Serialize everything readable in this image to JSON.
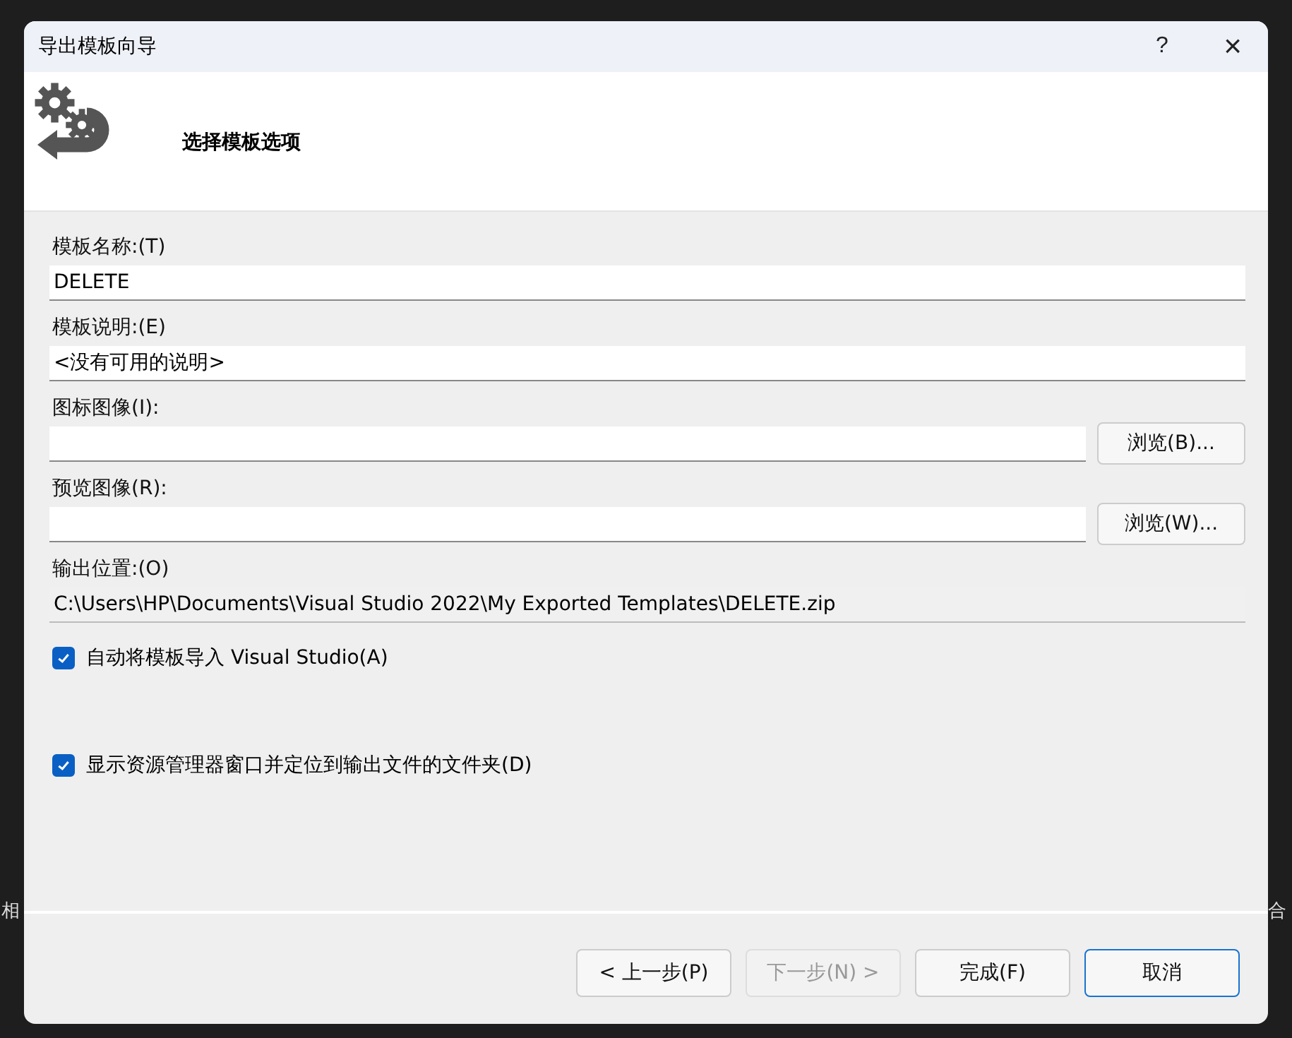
{
  "background": {
    "fragments_left": [
      "相"
    ],
    "fragments_right": [
      "合"
    ]
  },
  "window": {
    "title": "导出模板向导",
    "help": "?",
    "close": "×"
  },
  "header": {
    "title": "选择模板选项"
  },
  "fields": [
    {
      "label": "模板名称:(T)",
      "value": "DELETE",
      "kind": "text"
    },
    {
      "label": "模板说明:(E)",
      "value": "<没有可用的说明>",
      "kind": "text"
    },
    {
      "label": "图标图像(I):",
      "kind": "browse",
      "button": "浏览(B)..."
    },
    {
      "label": "预览图像(R):",
      "kind": "browse",
      "button": "浏览(W)..."
    },
    {
      "label": "输出位置:(O)",
      "value": "C:\\Users\\HP\\Documents\\Visual Studio 2022\\My Exported Templates\\DELETE.zip",
      "kind": "readonly"
    }
  ],
  "options": [
    {
      "label": "自动将模板导入 Visual Studio(A)",
      "checked": true
    },
    {
      "label": "显示资源管理器窗口并定位到输出文件的文件夹(D)",
      "checked": true
    }
  ],
  "buttons": [
    {
      "label": "< 上一步(P)",
      "disabled": false,
      "default": false
    },
    {
      "label": "下一步(N) >",
      "disabled": true,
      "default": false
    },
    {
      "label": "完成(F)",
      "disabled": false,
      "default": false
    },
    {
      "label": "取消",
      "disabled": false,
      "default": true
    }
  ]
}
